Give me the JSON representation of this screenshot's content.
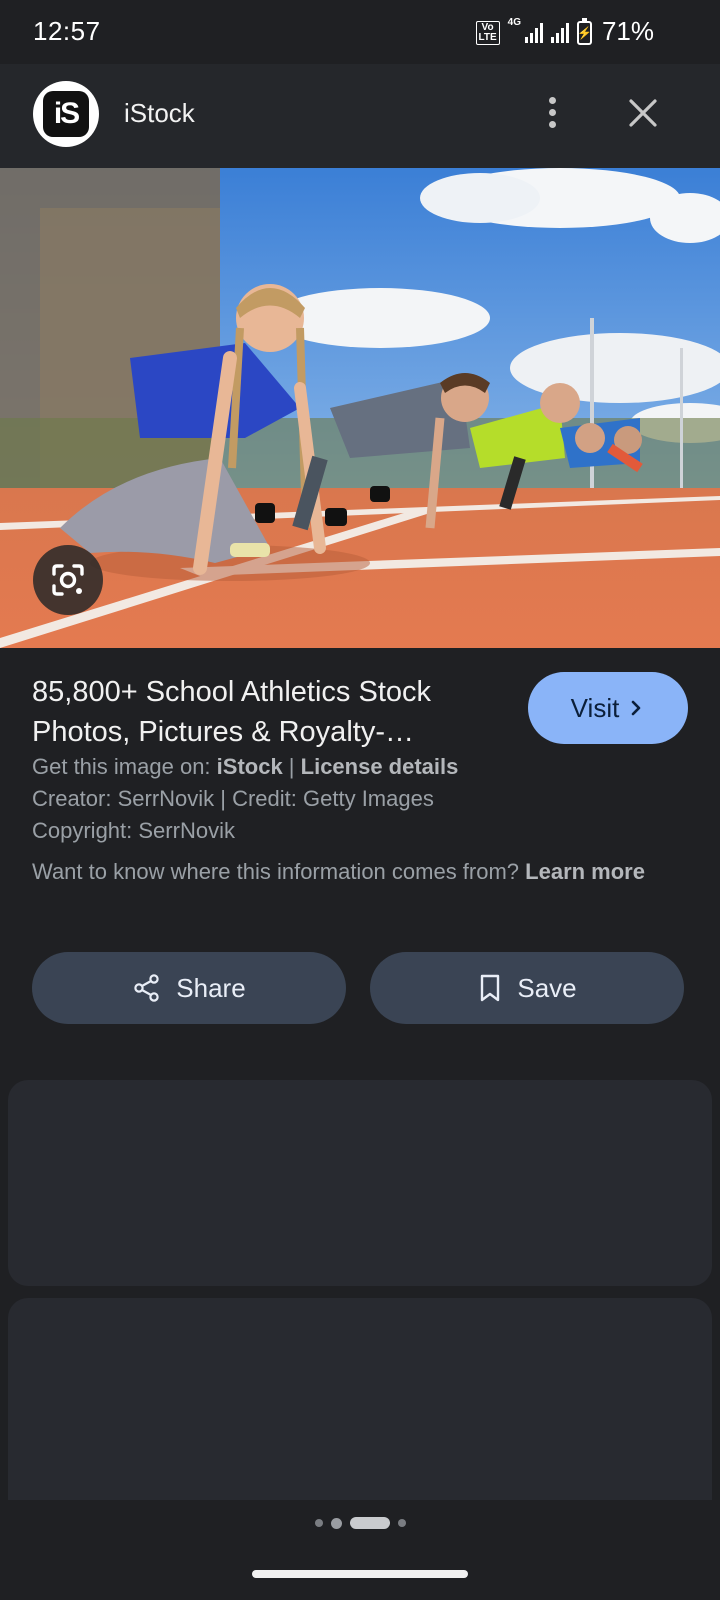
{
  "status_bar": {
    "time": "12:57",
    "volte_top": "Vo",
    "volte_bottom": "LTE",
    "network": "4G",
    "battery_percent": "71%"
  },
  "header": {
    "logo_text": "iS",
    "site_name": "iStock",
    "more_icon": "more-vert-icon",
    "close_icon": "close-icon"
  },
  "hero": {
    "lens_icon": "google-lens-icon"
  },
  "result": {
    "title": "85,800+ School Athletics Stock Photos, Pictures & Royalty-…",
    "visit_label": "Visit",
    "get_image_prefix": "Get this image on: ",
    "source": "iStock",
    "separator": " | ",
    "license_label": "License details",
    "creator_line": "Creator: SerrNovik | Credit: Getty Images",
    "copyright_line": "Copyright: SerrNovik",
    "info_question": "Want to know where this information comes from? ",
    "learn_more": "Learn more"
  },
  "actions": {
    "share_label": "Share",
    "save_label": "Save"
  },
  "colors": {
    "background": "#1f2023",
    "header": "#25272b",
    "visit_button": "#8ab4f8",
    "action_button": "#3a4454",
    "card": "#282a30"
  }
}
